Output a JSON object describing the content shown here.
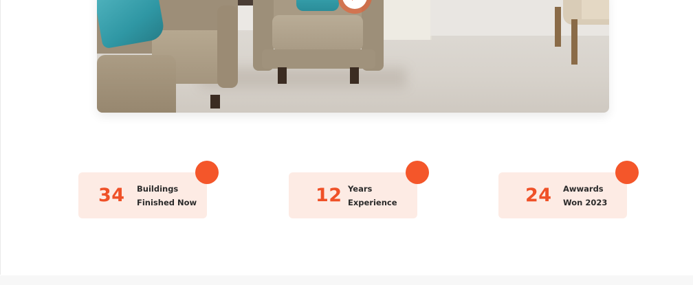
{
  "colors": {
    "accent": "#f4562a",
    "card_background": "#fdebe4",
    "number_text": "#ef5128",
    "label_text": "#2a2a2a"
  },
  "hero": {
    "play_icon": "play-icon"
  },
  "stats": [
    {
      "number": "34",
      "label_line1": "Buildings",
      "label_line2": "Finished Now"
    },
    {
      "number": "12",
      "label_line1": "Years",
      "label_line2": "Experience"
    },
    {
      "number": "24",
      "label_line1": "Awwards",
      "label_line2": "Won 2023"
    }
  ]
}
